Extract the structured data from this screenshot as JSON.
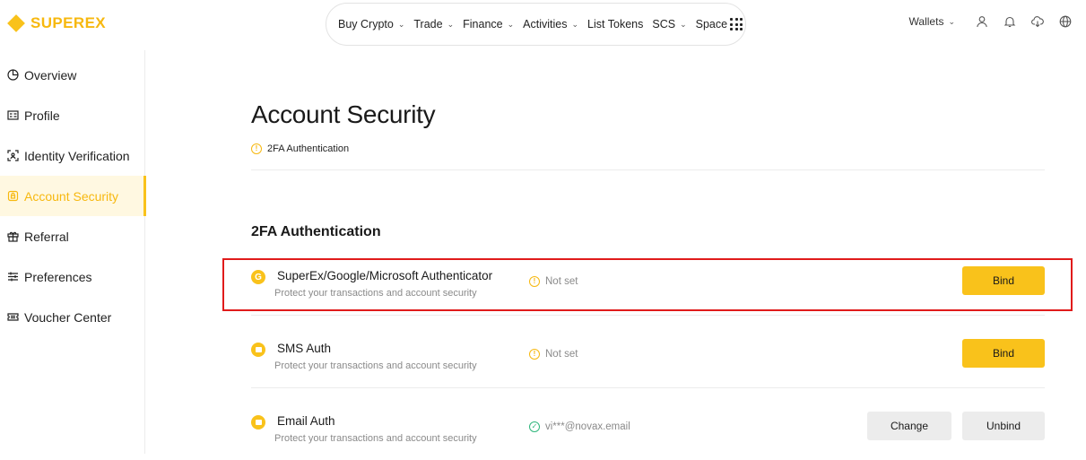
{
  "header": {
    "logo_text": "SUPEREX",
    "nav": [
      {
        "label": "Buy Crypto",
        "dropdown": true
      },
      {
        "label": "Trade",
        "dropdown": true
      },
      {
        "label": "Finance",
        "dropdown": true
      },
      {
        "label": "Activities",
        "dropdown": true
      },
      {
        "label": "List Tokens",
        "dropdown": false
      },
      {
        "label": "SCS",
        "dropdown": true
      },
      {
        "label": "Space",
        "dropdown": false
      }
    ],
    "wallets_label": "Wallets"
  },
  "sidebar": {
    "items": [
      {
        "label": "Overview",
        "icon": "pie-chart-icon",
        "active": false
      },
      {
        "label": "Profile",
        "icon": "id-card-icon",
        "active": false
      },
      {
        "label": "Identity Verification",
        "icon": "scan-face-icon",
        "active": false
      },
      {
        "label": "Account Security",
        "icon": "shield-icon",
        "active": true
      },
      {
        "label": "Referral",
        "icon": "gift-icon",
        "active": false
      },
      {
        "label": "Preferences",
        "icon": "sliders-icon",
        "active": false
      },
      {
        "label": "Voucher Center",
        "icon": "ticket-icon",
        "active": false
      }
    ]
  },
  "main": {
    "title": "Account Security",
    "notice": "2FA Authentication",
    "section_title": "2FA Authentication",
    "methods": [
      {
        "name": "SuperEx/Google/Microsoft Authenticator",
        "desc": "Protect your transactions and account security",
        "status": "Not set",
        "status_type": "warning",
        "icon": "google-auth-icon",
        "buttons": [
          "Bind"
        ]
      },
      {
        "name": "SMS Auth",
        "desc": "Protect your transactions and account security",
        "status": "Not set",
        "status_type": "warning",
        "icon": "sms-icon",
        "buttons": [
          "Bind"
        ]
      },
      {
        "name": "Email Auth",
        "desc": "Protect your transactions and account security",
        "status": "vi***@novax.email",
        "status_type": "ok",
        "icon": "email-icon",
        "buttons": [
          "Change",
          "Unbind"
        ]
      }
    ]
  },
  "colors": {
    "accent": "#f9c21b",
    "brand": "#f7b80f",
    "highlight": "#e01b1b",
    "ok": "#2fb67c"
  }
}
